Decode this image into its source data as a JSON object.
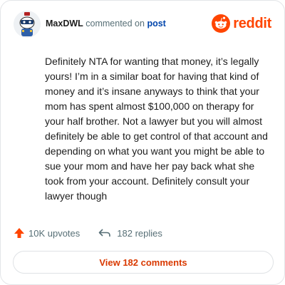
{
  "header": {
    "username": "MaxDWL",
    "action": "commented on",
    "target": "post",
    "brand_name": "reddit",
    "brand_icon": "reddit-logo-icon",
    "avatar_icon": "snoo-avatar-icon"
  },
  "comment": {
    "text": "Definitely NTA for wanting that money, it’s legally yours! I’m in a similar boat for having that kind of money and it’s insane anyways to think that your mom has spent almost $100,000 on therapy for your half brother. Not a lawyer but you will almost definitely be able to get control of that account and depending on what you want you might be able to sue your mom and have her pay back what she took from your account. Definitely consult your lawyer though"
  },
  "stats": {
    "upvotes": "10K upvotes",
    "replies": "182 replies",
    "upvote_icon": "upvote-arrow-icon",
    "reply_icon": "reply-arrow-icon"
  },
  "view_button": {
    "label": "View 182 comments"
  },
  "colors": {
    "brand": "#ff4500",
    "link": "#0045ac",
    "text": "#1c1c1c",
    "muted": "#576f76",
    "button_text": "#d93900",
    "border": "#e3e5e8"
  }
}
